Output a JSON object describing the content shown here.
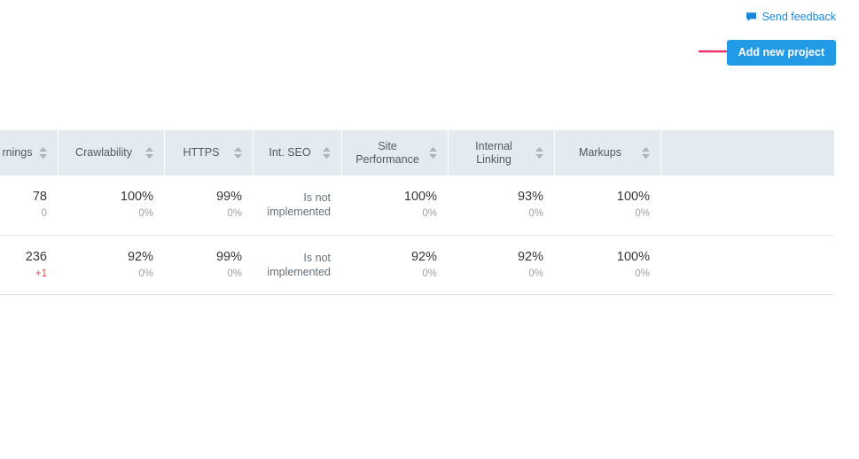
{
  "header": {
    "feedback_label": "Send feedback",
    "feedback_icon": "speech-bubble-icon",
    "add_project_label": "Add new project",
    "annotation_arrow": "right-arrow-annotation",
    "accent_blue": "#229ae6",
    "link_blue": "#1a88d8",
    "annotation_pink": "#e8336d"
  },
  "table": {
    "sort_icon": "sort-updown-icon",
    "columns": [
      {
        "label": "rnings",
        "name": "warnings",
        "sortable": true,
        "lines": [
          "rnings"
        ]
      },
      {
        "label": "Crawlability",
        "name": "crawlability",
        "sortable": true,
        "lines": [
          "Crawlability"
        ]
      },
      {
        "label": "HTTPS",
        "name": "https",
        "sortable": true,
        "lines": [
          "HTTPS"
        ]
      },
      {
        "label": "Int. SEO",
        "name": "int-seo",
        "sortable": true,
        "lines": [
          "Int. SEO"
        ]
      },
      {
        "label": "Site Performance",
        "name": "site-performance",
        "sortable": true,
        "lines": [
          "Site",
          "Performance"
        ]
      },
      {
        "label": "Internal Linking",
        "name": "internal-linking",
        "sortable": true,
        "lines": [
          "Internal",
          "Linking"
        ]
      },
      {
        "label": "Markups",
        "name": "markups",
        "sortable": true,
        "lines": [
          "Markups"
        ]
      },
      {
        "label": "",
        "name": "spacer",
        "sortable": false,
        "lines": []
      }
    ],
    "rows": [
      {
        "cells": [
          {
            "main": "78",
            "sub": "0",
            "sub_state": "neutral",
            "multiline": false
          },
          {
            "main": "100%",
            "sub": "0%",
            "sub_state": "neutral",
            "multiline": false
          },
          {
            "main": "99%",
            "sub": "0%",
            "sub_state": "neutral",
            "multiline": false
          },
          {
            "main": "Is not implemented",
            "sub": "",
            "sub_state": "neutral",
            "multiline": true
          },
          {
            "main": "100%",
            "sub": "0%",
            "sub_state": "neutral",
            "multiline": false
          },
          {
            "main": "93%",
            "sub": "0%",
            "sub_state": "neutral",
            "multiline": false
          },
          {
            "main": "100%",
            "sub": "0%",
            "sub_state": "neutral",
            "multiline": false
          },
          {
            "main": "",
            "sub": "",
            "sub_state": "neutral",
            "multiline": false
          }
        ]
      },
      {
        "cells": [
          {
            "main": "236",
            "sub": "+1",
            "sub_state": "up",
            "multiline": false
          },
          {
            "main": "92%",
            "sub": "0%",
            "sub_state": "neutral",
            "multiline": false
          },
          {
            "main": "99%",
            "sub": "0%",
            "sub_state": "neutral",
            "multiline": false
          },
          {
            "main": "Is not implemented",
            "sub": "",
            "sub_state": "neutral",
            "multiline": true
          },
          {
            "main": "92%",
            "sub": "0%",
            "sub_state": "neutral",
            "multiline": false
          },
          {
            "main": "92%",
            "sub": "0%",
            "sub_state": "neutral",
            "multiline": false
          },
          {
            "main": "100%",
            "sub": "0%",
            "sub_state": "neutral",
            "multiline": false
          },
          {
            "main": "",
            "sub": "",
            "sub_state": "neutral",
            "multiline": false
          }
        ]
      }
    ]
  }
}
